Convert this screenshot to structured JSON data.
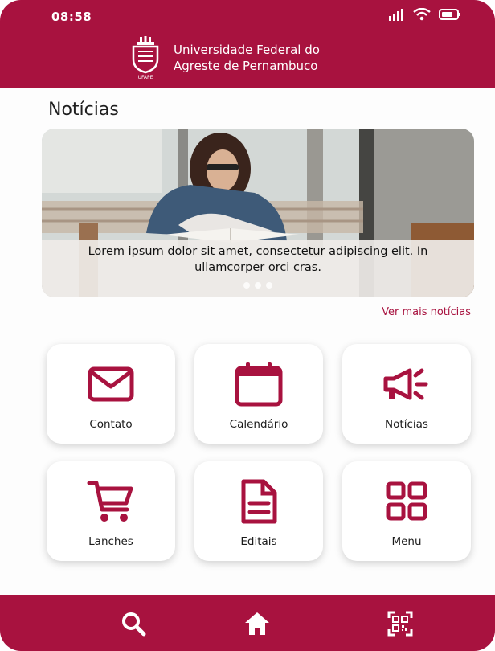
{
  "status_bar": {
    "time": "08:58"
  },
  "header": {
    "logo_text": "UFAPE",
    "university_name_line1": "Universidade Federal do",
    "university_name_line2": "Agreste de Pernambuco"
  },
  "news": {
    "title": "Notícias",
    "carousel": {
      "caption": "Lorem ipsum dolor sit amet, consectetur adipiscing elit. In ullamcorper orci cras.",
      "slide_count": 3,
      "active_index": 0
    },
    "see_more_label": "Ver mais notícias"
  },
  "menu": {
    "tiles": [
      {
        "label": "Contato",
        "icon": "mail-icon"
      },
      {
        "label": "Calendário",
        "icon": "calendar-icon"
      },
      {
        "label": "Notícias",
        "icon": "megaphone-icon"
      },
      {
        "label": "Lanches",
        "icon": "cart-icon"
      },
      {
        "label": "Editais",
        "icon": "document-icon"
      },
      {
        "label": "Menu",
        "icon": "grid-icon"
      }
    ]
  },
  "bottom_nav": {
    "items": [
      {
        "icon": "search-icon"
      },
      {
        "icon": "home-icon"
      },
      {
        "icon": "qr-code-icon"
      }
    ]
  },
  "colors": {
    "primary": "#a8123f",
    "background": "#fdfdfd",
    "text": "#1b1b1b"
  }
}
